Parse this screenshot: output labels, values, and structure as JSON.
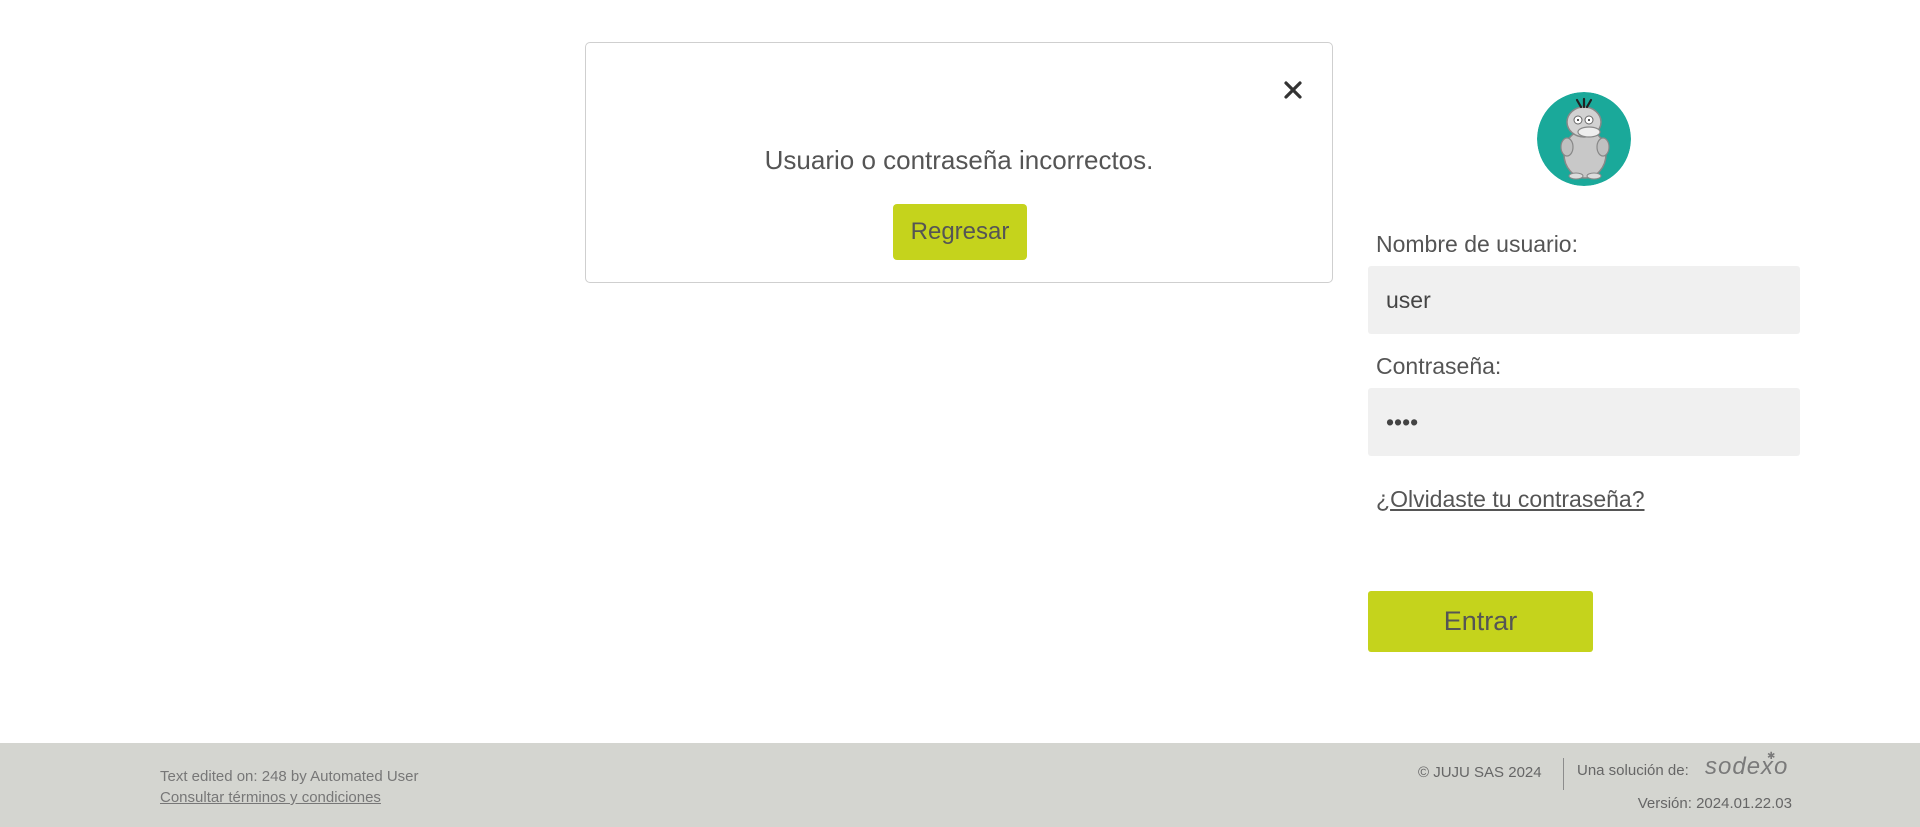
{
  "modal": {
    "message": "Usuario o contraseña incorrectos.",
    "button_label": "Regresar",
    "close_icon": "close-icon"
  },
  "login": {
    "avatar_icon": "psyduck-avatar",
    "username_label": "Nombre de usuario:",
    "username_value": "user",
    "password_label": "Contraseña:",
    "password_value": "••••",
    "forgot_prefix": "¿",
    "forgot_link": "Olvidaste tu contraseña?",
    "submit_label": "Entrar"
  },
  "footer": {
    "edited_text": "Text edited on: 248 by Automated User",
    "terms_link": "Consultar términos y condiciones",
    "copyright": "© JUJU SAS 2024",
    "solution_label": "Una solución de:",
    "brand": "sodexo",
    "version": "Versión: 2024.01.22.03"
  },
  "colors": {
    "accent": "#c5d31c",
    "avatar_bg": "#1aa99a",
    "footer_bg": "#d4d5d0",
    "field_bg": "#f0f0f0"
  }
}
